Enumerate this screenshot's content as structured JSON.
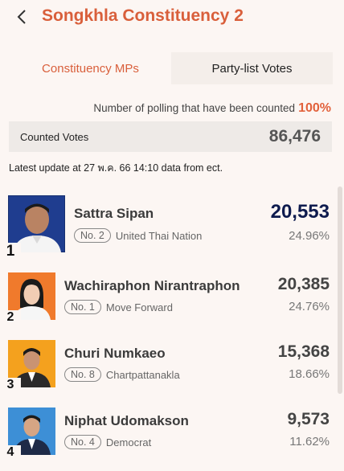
{
  "header": {
    "title": "Songkhla Constituency 2"
  },
  "tabs": [
    {
      "label": "Constituency MPs",
      "active": true
    },
    {
      "label": "Party-list Votes",
      "active": false
    }
  ],
  "polling": {
    "label": "Number of polling that have been counted",
    "percent": "100%"
  },
  "counted": {
    "label": "Counted Votes",
    "value": "86,476"
  },
  "update": {
    "text": "Latest update at 27 พ.ค. 66 14:10 data from ect."
  },
  "candidates": [
    {
      "rank": "1",
      "name": "Sattra Sipan",
      "number": "No. 2",
      "party": "United Thai Nation",
      "votes": "20,553",
      "percent": "24.96%"
    },
    {
      "rank": "2",
      "name": "Wachiraphon Nirantraphon",
      "number": "No. 1",
      "party": "Move Forward",
      "votes": "20,385",
      "percent": "24.76%"
    },
    {
      "rank": "3",
      "name": "Churi Numkaeo",
      "number": "No. 8",
      "party": "Chartpattanakla",
      "votes": "15,368",
      "percent": "18.66%"
    },
    {
      "rank": "4",
      "name": "Niphat Udomakson",
      "number": "No. 4",
      "party": "Democrat",
      "votes": "9,573",
      "percent": "11.62%"
    }
  ],
  "colors": {
    "accent": "#d95f3b",
    "leader": "#0e1b4e",
    "background": "#fcf6f3"
  },
  "icons": {
    "back": "chevron-left-icon"
  }
}
